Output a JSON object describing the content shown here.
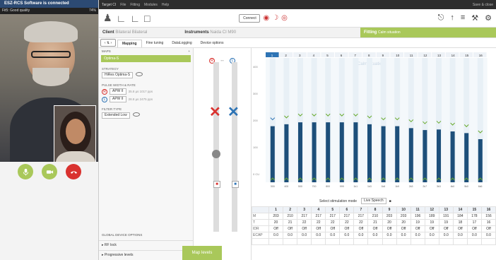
{
  "video_call": {
    "status": "ESZ-RCS Software is connected",
    "quality": "Fit5: Good quality",
    "signal": "74%",
    "controls": [
      "microphone-icon",
      "camera-icon",
      "hangup-icon"
    ],
    "colors": {
      "mic": "#a9c85a",
      "cam": "#a9c85a",
      "hangup": "#d9322f"
    }
  },
  "titlebar": {
    "app": "Target CI",
    "menu": [
      "File",
      "Fitting",
      "Modules",
      "Help"
    ],
    "right": "Save & close"
  },
  "toolbar": {
    "connect": "Connect",
    "icons": [
      "user-icon",
      "implant-icon",
      "implant-icon",
      "document-icon",
      "sound-icon",
      "settings-icon",
      "network-icon",
      "equalizer-icon",
      "tools-icon"
    ]
  },
  "crumbs": {
    "client": "Client",
    "client_sub": "Bilateral Bilateral",
    "instruments": "Instruments",
    "instruments_sub": "Naida CI M90",
    "fitting": "Fitting",
    "fitting_sub": "Calm situation"
  },
  "subnav": {
    "tabs": [
      "Mapping",
      "Fine tuning",
      "DataLogging",
      "Device options"
    ],
    "active": "Mapping"
  },
  "left": {
    "maps": "MAPS",
    "map_sel": "Optima-S",
    "strategy_lbl": "STRATEGY",
    "strategy": "HiRes Optima-S",
    "pw_lbl": "PULSE WIDTH & RATE",
    "pw": [
      {
        "ear": "R",
        "apw": "APW II",
        "val": "35.8 µs 1017 pps",
        "color": "#d9322f"
      },
      {
        "ear": "L",
        "apw": "APW II",
        "val": "28.8 µs 2475 pps",
        "color": "#2e74b5"
      }
    ],
    "filter_lbl": "FILTER TYPE",
    "filter": "Extended Low",
    "gdo": "GLOBAL DEVICE OPTIONS",
    "acc": [
      "RF lock",
      "Progressive levels"
    ]
  },
  "chart": {
    "label": "Calm situation",
    "ylabels": [
      "400",
      "300",
      "200",
      "100",
      "0 CU"
    ]
  },
  "chart_data": {
    "type": "bar",
    "categories": [
      "1",
      "2",
      "3",
      "4",
      "5",
      "6",
      "7",
      "8",
      "9",
      "10",
      "11",
      "12",
      "13",
      "14",
      "15",
      "16"
    ],
    "series": [
      {
        "name": "M",
        "values": [
          203,
          210,
          217,
          217,
          217,
          217,
          217,
          210,
          203,
          203,
          196,
          189,
          191,
          184,
          178,
          156
        ]
      },
      {
        "name": "T",
        "values": [
          20,
          21,
          22,
          22,
          22,
          22,
          22,
          21,
          20,
          20,
          19,
          19,
          19,
          18,
          17,
          16
        ]
      }
    ],
    "freq_labels": [
      "300",
      "400",
      "500",
      "700",
      "800",
      "999",
      "1k1",
      "1k3",
      "1k6",
      "1k9",
      "2k3",
      "2k7",
      "3k3",
      "4k0",
      "5k0",
      "6k6"
    ],
    "ylim": [
      0,
      450
    ]
  },
  "sim": {
    "label": "Select stimulation mode",
    "mode": "Live Speech"
  },
  "table": {
    "rows": [
      {
        "h": "M",
        "vals": [
          "203",
          "210",
          "217",
          "217",
          "217",
          "217",
          "217",
          "210",
          "203",
          "203",
          "196",
          "189",
          "191",
          "184",
          "178",
          "156"
        ]
      },
      {
        "h": "T",
        "vals": [
          "20",
          "21",
          "22",
          "22",
          "22",
          "22",
          "22",
          "21",
          "20",
          "20",
          "19",
          "19",
          "19",
          "18",
          "17",
          "16"
        ]
      },
      {
        "h": "IDR",
        "vals": [
          "Off",
          "Off",
          "Off",
          "Off",
          "Off",
          "Off",
          "Off",
          "Off",
          "Off",
          "Off",
          "Off",
          "Off",
          "Off",
          "Off",
          "Off",
          "Off"
        ]
      },
      {
        "h": "ECAP",
        "vals": [
          "0.0",
          "0.0",
          "0.0",
          "0.0",
          "0.0",
          "0.0",
          "0.0",
          "0.0",
          "0.0",
          "0.0",
          "0.0",
          "0.0",
          "0.0",
          "0.0",
          "0.0",
          "0.0"
        ]
      },
      {
        "h": "",
        "vals": [
          "",
          "",
          "",
          "",
          "",
          "",
          "",
          "",
          "",
          "",
          "",
          "",
          "",
          "",
          "",
          ""
        ]
      }
    ]
  },
  "map_levels": "Map levels"
}
